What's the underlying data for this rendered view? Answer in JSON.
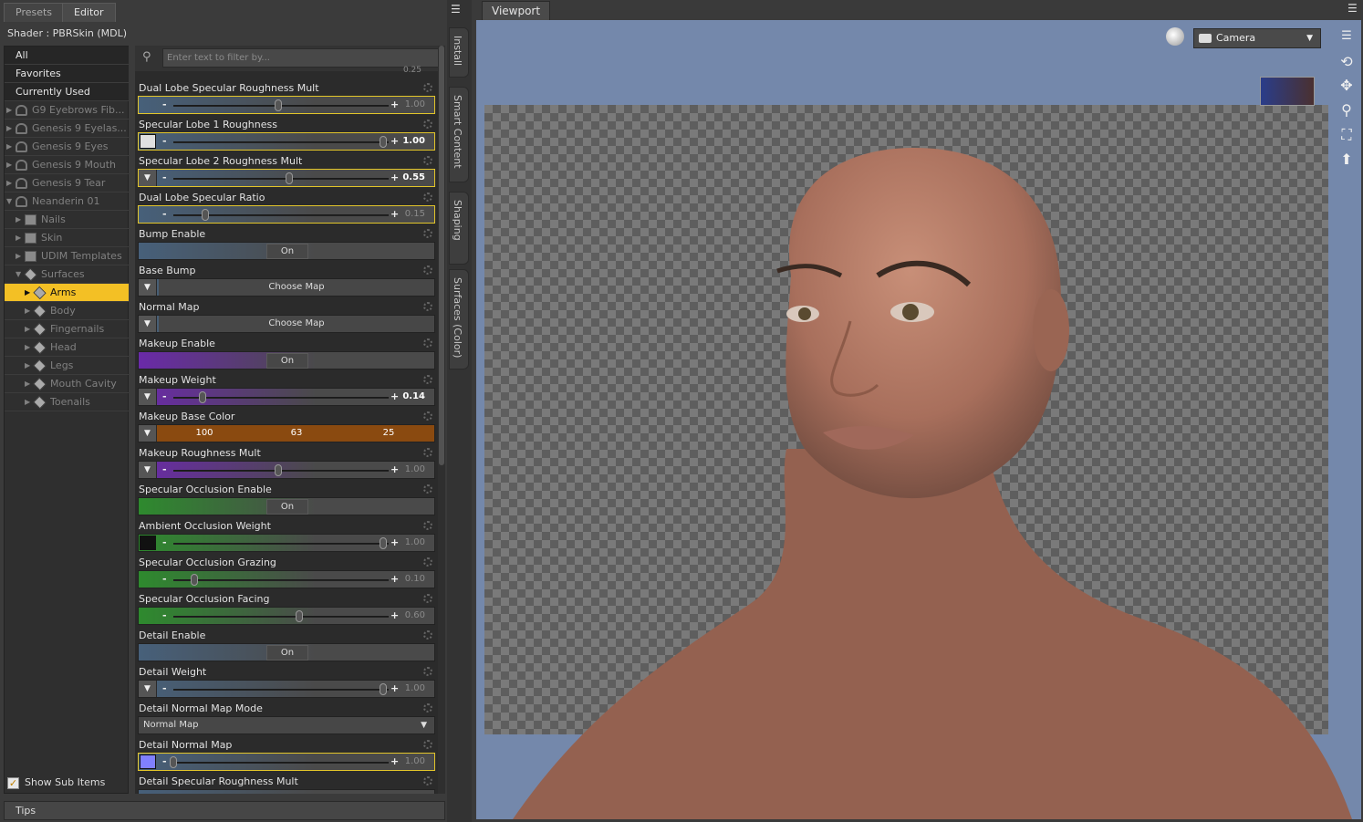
{
  "tabs": {
    "presets": "Presets",
    "editor": "Editor"
  },
  "shader_label": "Shader : PBRSkin (MDL)",
  "tree": {
    "top": [
      "All",
      "Favorites",
      "Currently Used"
    ],
    "items": [
      {
        "label": "G9 Eyebrows Fib...",
        "indent": 0,
        "arrow": "▶",
        "icon": "figure"
      },
      {
        "label": "Genesis 9 Eyelas...",
        "indent": 0,
        "arrow": "▶",
        "icon": "figure"
      },
      {
        "label": "Genesis 9 Eyes",
        "indent": 0,
        "arrow": "▶",
        "icon": "figure"
      },
      {
        "label": "Genesis 9 Mouth",
        "indent": 0,
        "arrow": "▶",
        "icon": "figure"
      },
      {
        "label": "Genesis 9 Tear",
        "indent": 0,
        "arrow": "▶",
        "icon": "figure"
      },
      {
        "label": "Neanderin 01",
        "indent": 0,
        "arrow": "▼",
        "icon": "figure"
      },
      {
        "label": "Nails",
        "indent": 1,
        "arrow": "▶",
        "icon": "folder"
      },
      {
        "label": "Skin",
        "indent": 1,
        "arrow": "▶",
        "icon": "folder"
      },
      {
        "label": "UDIM Templates",
        "indent": 1,
        "arrow": "▶",
        "icon": "folder"
      },
      {
        "label": "Surfaces",
        "indent": 1,
        "arrow": "▼",
        "icon": "surface"
      },
      {
        "label": "Arms",
        "indent": 2,
        "arrow": "▶",
        "icon": "surface",
        "selected": true
      },
      {
        "label": "Body",
        "indent": 2,
        "arrow": "▶",
        "icon": "surface"
      },
      {
        "label": "Fingernails",
        "indent": 2,
        "arrow": "▶",
        "icon": "surface"
      },
      {
        "label": "Head",
        "indent": 2,
        "arrow": "▶",
        "icon": "surface"
      },
      {
        "label": "Legs",
        "indent": 2,
        "arrow": "▶",
        "icon": "surface"
      },
      {
        "label": "Mouth Cavity",
        "indent": 2,
        "arrow": "▶",
        "icon": "surface"
      },
      {
        "label": "Toenails",
        "indent": 2,
        "arrow": "▶",
        "icon": "surface"
      }
    ]
  },
  "show_sub_items": "Show Sub Items",
  "filter_placeholder": "Enter text to filter by...",
  "partial_top_value": "0.25",
  "properties": [
    {
      "name": "Dual Lobe Specular Roughness Mult",
      "type": "slider",
      "value": "1.00",
      "pos": 0.5,
      "hl": true
    },
    {
      "name": "Specular Lobe 1 Roughness",
      "type": "slider",
      "value": "1.00",
      "pos": 1.0,
      "hl": true,
      "swatch": "#e0e0e0",
      "bright": true
    },
    {
      "name": "Specular Lobe 2 Roughness Mult",
      "type": "slider",
      "value": "0.55",
      "pos": 0.55,
      "hl": true,
      "bright": true
    },
    {
      "name": "Dual Lobe Specular Ratio",
      "type": "slider",
      "value": "0.15",
      "pos": 0.15,
      "hl": true
    },
    {
      "name": "Bump Enable",
      "type": "toggle",
      "value": "On"
    },
    {
      "name": "Base Bump",
      "type": "map",
      "value": "Choose Map"
    },
    {
      "name": "Normal Map",
      "type": "map",
      "value": "Choose Map"
    },
    {
      "name": "Makeup Enable",
      "type": "toggle",
      "value": "On",
      "tint": "#6a2aa8"
    },
    {
      "name": "Makeup Weight",
      "type": "slider",
      "value": "0.14",
      "pos": 0.14,
      "tint": "#6a2aa8",
      "bright": true
    },
    {
      "name": "Makeup Base Color",
      "type": "color",
      "values": [
        "100",
        "63",
        "25"
      ]
    },
    {
      "name": "Makeup Roughness Mult",
      "type": "slider",
      "value": "1.00",
      "pos": 0.5,
      "tint": "#6a2aa8"
    },
    {
      "name": "Specular Occlusion Enable",
      "type": "toggle",
      "value": "On",
      "tint": "#2e8a2e"
    },
    {
      "name": "Ambient Occlusion Weight",
      "type": "slider",
      "value": "1.00",
      "pos": 1.0,
      "tint": "#2e8a2e",
      "swatch": "#111111"
    },
    {
      "name": "Specular Occlusion Grazing",
      "type": "slider",
      "value": "0.10",
      "pos": 0.1,
      "tint": "#2e8a2e"
    },
    {
      "name": "Specular Occlusion Facing",
      "type": "slider",
      "value": "0.60",
      "pos": 0.6,
      "tint": "#2e8a2e"
    },
    {
      "name": "Detail Enable",
      "type": "toggle",
      "value": "On"
    },
    {
      "name": "Detail Weight",
      "type": "slider",
      "value": "1.00",
      "pos": 1.0
    },
    {
      "name": "Detail Normal Map Mode",
      "type": "select",
      "value": "Normal Map"
    },
    {
      "name": "Detail Normal Map",
      "type": "slider",
      "value": "1.00",
      "pos": 0.0,
      "hl": true,
      "swatch": "#8080ff"
    },
    {
      "name": "Detail Specular Roughness Mult",
      "type": "partial"
    }
  ],
  "tips": "Tips",
  "side_tabs": [
    "Install",
    "Smart Content",
    "Shaping",
    "Surfaces (Color)"
  ],
  "viewport_tab": "Viewport",
  "camera": "Camera"
}
